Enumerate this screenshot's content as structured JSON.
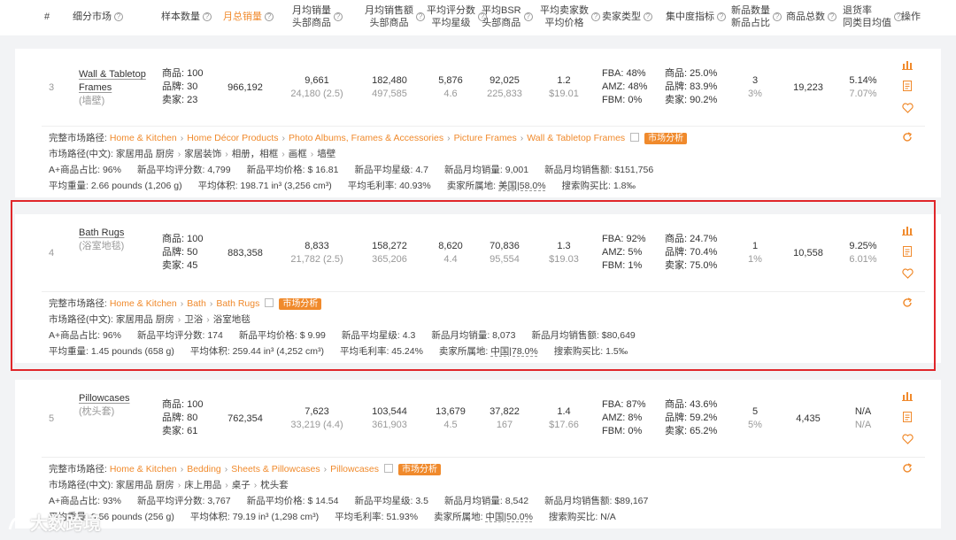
{
  "header": {
    "cols": [
      {
        "label": "#",
        "q": false
      },
      {
        "label": "细分市场",
        "q": true
      },
      {
        "label": "样本数量",
        "q": true
      },
      {
        "label": "月总销量",
        "q": true
      },
      {
        "label": "月均销量\n头部商品",
        "q": true
      },
      {
        "label": "月均销售额\n头部商品",
        "q": true
      },
      {
        "label": "平均评分数\n平均星级",
        "q": true
      },
      {
        "label": "平均BSR\n头部商品",
        "q": true
      },
      {
        "label": "平均卖家数\n平均价格",
        "q": true
      },
      {
        "label": "卖家类型",
        "q": true
      },
      {
        "label": "集中度指标",
        "q": true
      },
      {
        "label": "新品数量\n新品占比",
        "q": true
      },
      {
        "label": "商品总数",
        "q": true
      },
      {
        "label": "退货率\n同类目均值",
        "q": true
      },
      {
        "label": "操作",
        "q": false
      }
    ]
  },
  "rows": [
    {
      "index": "3",
      "name_l1": "Wall & Tabletop",
      "name_l2": "Frames",
      "name_cn": "(墙壁)",
      "sample": [
        "商品: 100",
        "品牌: 30",
        "卖家: 23"
      ],
      "total_sales": "966,192",
      "avg_sales": "9,661",
      "avg_sales_sub": "24,180 (2.5)",
      "avg_revenue": "182,480",
      "avg_revenue_sub": "497,585",
      "avg_reviews": "5,876",
      "avg_rating": "4.6",
      "avg_bsr": "92,025",
      "avg_bsr_sub": "225,833",
      "avg_sellers": "1.2",
      "avg_price": "$19.01",
      "seller_type": [
        "FBA: 48%",
        "AMZ: 48%",
        "FBM: 0%"
      ],
      "concentration": [
        "商品: 25.0%",
        "品牌: 83.9%",
        "卖家: 90.2%"
      ],
      "new_count": "3",
      "new_pct": "3%",
      "total_products": "19,223",
      "return_rate": "5.14%",
      "return_avg": "7.07%",
      "path_label": "完整市场路径:",
      "path": [
        "Home & Kitchen",
        "Home Décor Products",
        "Photo Albums, Frames & Accessories",
        "Picture Frames",
        "Wall & Tabletop Frames"
      ],
      "tag": "市场分析",
      "path_cn_label": "市场路径(中文):",
      "path_cn": [
        "家居用品 厨房",
        "家居装饰",
        "相册，相框",
        "画框",
        "墙壁"
      ],
      "stats1": [
        "A+商品占比: 96%",
        "新品平均评分数: 4,799",
        "新品平均价格: $ 16.81",
        "新品平均星级: 4.7",
        "新品月均销量: 9,001",
        "新品月均销售额: $151,756"
      ],
      "stats2": [
        "平均重量: 2.66 pounds (1,206 g)",
        "平均体积: 198.71 in³ (3,256 cm³)",
        "平均毛利率: 40.93%",
        "卖家所属地: ",
        "搜索购买比: 1.8‰"
      ],
      "origin": "美国|58.0%"
    },
    {
      "index": "4",
      "name_l1": "Bath Rugs",
      "name_l2": "",
      "name_cn": "(浴室地毯)",
      "sample": [
        "商品: 100",
        "品牌: 50",
        "卖家: 45"
      ],
      "total_sales": "883,358",
      "avg_sales": "8,833",
      "avg_sales_sub": "21,782 (2.5)",
      "avg_revenue": "158,272",
      "avg_revenue_sub": "365,206",
      "avg_reviews": "8,620",
      "avg_rating": "4.4",
      "avg_bsr": "70,836",
      "avg_bsr_sub": "95,554",
      "avg_sellers": "1.3",
      "avg_price": "$19.03",
      "seller_type": [
        "FBA: 92%",
        "AMZ: 5%",
        "FBM: 1%"
      ],
      "concentration": [
        "商品: 24.7%",
        "品牌: 70.4%",
        "卖家: 75.0%"
      ],
      "new_count": "1",
      "new_pct": "1%",
      "total_products": "10,558",
      "return_rate": "9.25%",
      "return_avg": "6.01%",
      "path_label": "完整市场路径:",
      "path": [
        "Home & Kitchen",
        "Bath",
        "Bath Rugs"
      ],
      "tag": "市场分析",
      "path_cn_label": "市场路径(中文):",
      "path_cn": [
        "家居用品 厨房",
        "卫浴",
        "浴室地毯"
      ],
      "stats1": [
        "A+商品占比: 96%",
        "新品平均评分数: 174",
        "新品平均价格: $ 9.99",
        "新品平均星级: 4.3",
        "新品月均销量: 8,073",
        "新品月均销售额: $80,649"
      ],
      "stats2": [
        "平均重量: 1.45 pounds (658 g)",
        "平均体积: 259.44 in³ (4,252 cm³)",
        "平均毛利率: 45.24%",
        "卖家所属地: ",
        "搜索购买比: 1.5‰"
      ],
      "origin": "中国|78.0%"
    },
    {
      "index": "5",
      "name_l1": "Pillowcases",
      "name_l2": "",
      "name_cn": "(枕头套)",
      "sample": [
        "商品: 100",
        "品牌: 80",
        "卖家: 61"
      ],
      "total_sales": "762,354",
      "avg_sales": "7,623",
      "avg_sales_sub": "33,219 (4.4)",
      "avg_revenue": "103,544",
      "avg_revenue_sub": "361,903",
      "avg_reviews": "13,679",
      "avg_rating": "4.5",
      "avg_bsr": "37,822",
      "avg_bsr_sub": "167",
      "avg_sellers": "1.4",
      "avg_price": "$17.66",
      "seller_type": [
        "FBA: 87%",
        "AMZ: 8%",
        "FBM: 0%"
      ],
      "concentration": [
        "商品: 43.6%",
        "品牌: 59.2%",
        "卖家: 65.2%"
      ],
      "new_count": "5",
      "new_pct": "5%",
      "total_products": "4,435",
      "return_rate": "N/A",
      "return_avg": "N/A",
      "path_label": "完整市场路径:",
      "path": [
        "Home & Kitchen",
        "Bedding",
        "Sheets & Pillowcases",
        "Pillowcases"
      ],
      "tag": "市场分析",
      "path_cn_label": "市场路径(中文):",
      "path_cn": [
        "家居用品 厨房",
        "床上用品",
        "桌子",
        "枕头套"
      ],
      "stats1": [
        "A+商品占比: 93%",
        "新品平均评分数: 3,767",
        "新品平均价格: $ 14.54",
        "新品平均星级: 3.5",
        "新品月均销量: 8,542",
        "新品月均销售额: $89,167"
      ],
      "stats2": [
        "平均重量: 0.56 pounds (256 g)",
        "平均体积: 79.19 in³ (1,298 cm³)",
        "平均毛利率: 51.93%",
        "卖家所属地: ",
        "搜索购买比: N/A"
      ],
      "origin": "中国|50.0%"
    }
  ],
  "watermark": "大数跨境",
  "colors": {
    "accent": "#f08a2c",
    "highlight": "#e0262a"
  },
  "icons": [
    "chart-icon",
    "document-icon",
    "heart-icon",
    "refresh-icon"
  ]
}
